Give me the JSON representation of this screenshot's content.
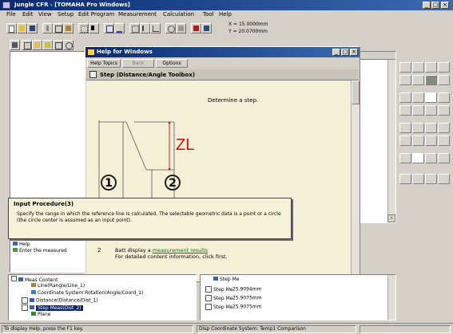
{
  "app": {
    "title": "Jungle CFR - [TOMAHA Pro Windows]",
    "menu": [
      "File",
      "Edit",
      "View",
      "Setup",
      "Edit Program",
      "Measurement",
      "Calculation",
      "Tool",
      "Help"
    ],
    "coord_readout": [
      "X = 15.0000mm",
      "Y = 20.0700mm"
    ]
  },
  "help_window": {
    "title": "Help for Windows",
    "buttons": [
      "Help Topics",
      "Back",
      "Options"
    ],
    "topic_title": "Step (Distance/Angle Toolbox)",
    "heading": "Determine a step.",
    "zl_label": "ZL",
    "circle_labels": [
      "1",
      "2"
    ],
    "step_number": "2",
    "step_text_prefix": "Batt display a",
    "step_link": "measurement results",
    "step_text_line2": "For detailed content information, click first."
  },
  "popup": {
    "title": "Input Procedure(3)",
    "body": "Specify the range in which the reference line is calculated. The selectable geometric data is a point or a circle (the circle center is assumed as an input point)."
  },
  "left_panel": {
    "items": [
      "Help",
      "Enter the measured"
    ]
  },
  "tree": {
    "root": "Meas Content",
    "items": [
      "Line(Rangle/Line_1)",
      "Coordinate System Rotation(Angle/Coord_1)",
      "Distance(Distance/Dist_1)",
      "Step Meas(Dist_2)",
      "Plane"
    ]
  },
  "results_list": {
    "header": "Step Me",
    "rows": [
      {
        "name": "Step Me",
        "value": "25.9094mm"
      },
      {
        "name": "Step Me",
        "value": "25.9075mm"
      },
      {
        "name": "Step Me",
        "value": "25.9075mm"
      }
    ]
  },
  "status_bar": {
    "left": "To display Help, press the F1 key.",
    "right": "Disp Coordinate System: Temp1  Comparison"
  },
  "colors": {
    "zl_red": "#cc1111",
    "help_bg": "#f4f0d8",
    "titlebar": "#0a2a6e"
  }
}
